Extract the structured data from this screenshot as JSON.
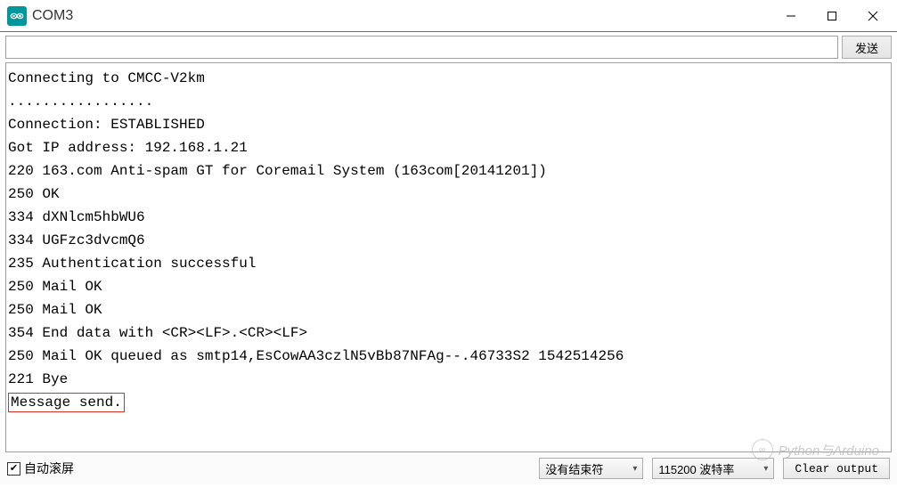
{
  "window": {
    "title": "COM3"
  },
  "toolbar": {
    "input_value": "",
    "send_label": "发送"
  },
  "console": {
    "lines": [
      "Connecting to CMCC-V2km",
      ".................",
      "Connection: ESTABLISHED",
      "Got IP address: 192.168.1.21",
      "220 163.com Anti-spam GT for Coremail System (163com[20141201])",
      "250 OK",
      "334 dXNlcm5hbWU6",
      "334 UGFzc3dvcmQ6",
      "235 Authentication successful",
      "250 Mail OK",
      "250 Mail OK",
      "354 End data with <CR><LF>.<CR><LF>",
      "250 Mail OK queued as smtp14,EsCowAA3czlN5vBb87NFAg--.46733S2 1542514256",
      "221 Bye"
    ],
    "highlighted_line": "Message send."
  },
  "statusbar": {
    "autoscroll_label": "自动滚屏",
    "autoscroll_checked": true,
    "line_ending": {
      "selected": "没有结束符"
    },
    "baud": {
      "selected": "115200 波特率"
    },
    "clear_label": "Clear output"
  },
  "watermark": {
    "text": "Python与Arduino"
  }
}
